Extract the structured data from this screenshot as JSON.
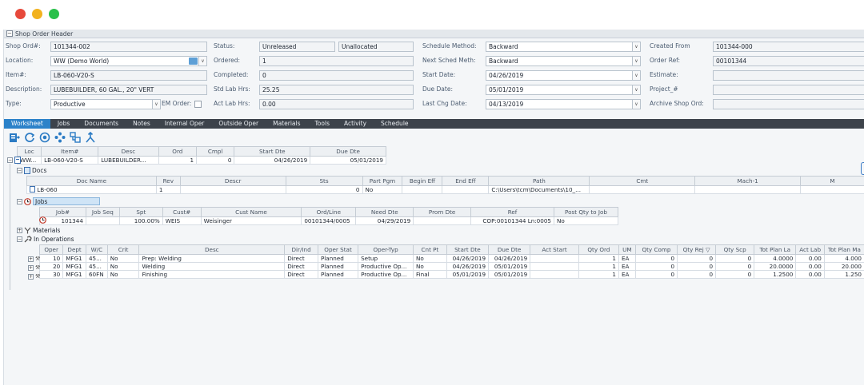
{
  "window": {
    "dots": [
      "#e7493b",
      "#f2b21f",
      "#29c04a"
    ]
  },
  "section_title": "Shop Order Header",
  "form": {
    "col1": [
      {
        "label": "Shop Ord#:",
        "value": "101344-002"
      },
      {
        "label": "Location:",
        "value": "WW (Demo World)"
      },
      {
        "label": "Item#:",
        "value": "LB-060-V20-S"
      },
      {
        "label": "Description:",
        "value": "LUBEBUILDER, 60 GAL., 20\" VERT"
      },
      {
        "label": "Type:",
        "value": "Productive"
      }
    ],
    "em_order_label": "EM Order:",
    "col2": [
      {
        "label": "Status:",
        "value": "Unreleased",
        "value2": "Unallocated"
      },
      {
        "label": "Ordered:",
        "value": "1"
      },
      {
        "label": "Completed:",
        "value": "0"
      },
      {
        "label": "Std Lab Hrs:",
        "value": "25.25"
      },
      {
        "label": "Act Lab Hrs:",
        "value": "0.00"
      }
    ],
    "col3": [
      {
        "label": "Schedule Method:",
        "value": "Backward"
      },
      {
        "label": "Next Sched Meth:",
        "value": "Backward"
      },
      {
        "label": "Start Date:",
        "value": "04/26/2019"
      },
      {
        "label": "Due Date:",
        "value": "05/01/2019"
      },
      {
        "label": "Last Chg Date:",
        "value": "04/13/2019"
      }
    ],
    "col4": [
      {
        "label": "Created From",
        "value": "101344-000"
      },
      {
        "label": "Order Ref:",
        "value": "00101344"
      },
      {
        "label": "Estimate:",
        "value": ""
      },
      {
        "label": "Project_#",
        "value": ""
      },
      {
        "label": "Archive Shop Ord:",
        "value": ""
      }
    ]
  },
  "tabs": [
    "Worksheet",
    "Jobs",
    "Documents",
    "Notes",
    "Internal Oper",
    "Outside Oper",
    "Materials",
    "Tools",
    "Activity",
    "Schedule"
  ],
  "toolbar_icons": [
    "export-icon",
    "refresh-icon",
    "target-icon",
    "move-icon",
    "hierarchy-icon",
    "merge-icon"
  ],
  "main_grid": {
    "headers": [
      "Loc",
      "Item#",
      "Desc",
      "Ord",
      "Cmpl",
      "Start Dte",
      "Due Dte"
    ],
    "row": [
      "WW...",
      "LB-060-V20-S",
      "LUBEBUILDER...",
      "1",
      "0",
      "04/26/2019",
      "05/01/2019"
    ]
  },
  "docs": {
    "label": "Docs",
    "headers": [
      "Doc Name",
      "Rev",
      "Descr",
      "Sts",
      "Part Pgm",
      "Begin Eff",
      "End Eff",
      "Path",
      "Cmt",
      "Mach-1",
      "M"
    ],
    "row": [
      "LB-060",
      "1",
      "",
      "0",
      "No",
      "",
      "",
      "C:\\Users\\tcm\\Documents\\10_...",
      "",
      "",
      ""
    ]
  },
  "jobs": {
    "label": "Jobs",
    "headers": [
      "Job#",
      "Job Seq",
      "Spt",
      "Cust#",
      "Cust Name",
      "Ord/Line",
      "Need Dte",
      "Prom Dte",
      "Ref",
      "Post Qty to Job"
    ],
    "row": [
      "101344",
      "",
      "100.00%",
      "WEIS",
      "Weisinger",
      "00101344/0005",
      "04/29/2019",
      "",
      "COP:00101344 Ln:0005",
      "No"
    ]
  },
  "materials_label": "Materials",
  "ops": {
    "label": "In Operations",
    "headers": [
      "Oper",
      "Dept",
      "W/C",
      "Crit",
      "Desc",
      "Dir/Ind",
      "Oper Stat",
      "Oper-Typ",
      "Cnt Pt",
      "Start Dte",
      "Due Dte",
      "Act Start",
      "Qty Ord",
      "UM",
      "Qty Comp",
      "Qty Rej ▽",
      "Qty Scp",
      "Tot Plan La",
      "Act Lab",
      "Tot Plan Ma"
    ],
    "rows": [
      [
        "10",
        "MFG1",
        "45...",
        "No",
        "Prep: Welding",
        "Direct",
        "Planned",
        "Setup",
        "No",
        "04/26/2019",
        "04/26/2019",
        "",
        "1",
        "EA",
        "0",
        "0",
        "0",
        "4.0000",
        "0.00",
        "4.000"
      ],
      [
        "20",
        "MFG1",
        "45...",
        "No",
        "Welding",
        "Direct",
        "Planned",
        "Productive Op...",
        "No",
        "04/26/2019",
        "05/01/2019",
        "",
        "1",
        "EA",
        "0",
        "0",
        "0",
        "20.0000",
        "0.00",
        "20.000"
      ],
      [
        "30",
        "MFG1",
        "60FN",
        "No",
        "Finishing",
        "Direct",
        "Planned",
        "Productive Op...",
        "Final",
        "05/01/2019",
        "05/01/2019",
        "",
        "1",
        "EA",
        "0",
        "0",
        "0",
        "1.2500",
        "0.00",
        "1.250"
      ]
    ]
  }
}
